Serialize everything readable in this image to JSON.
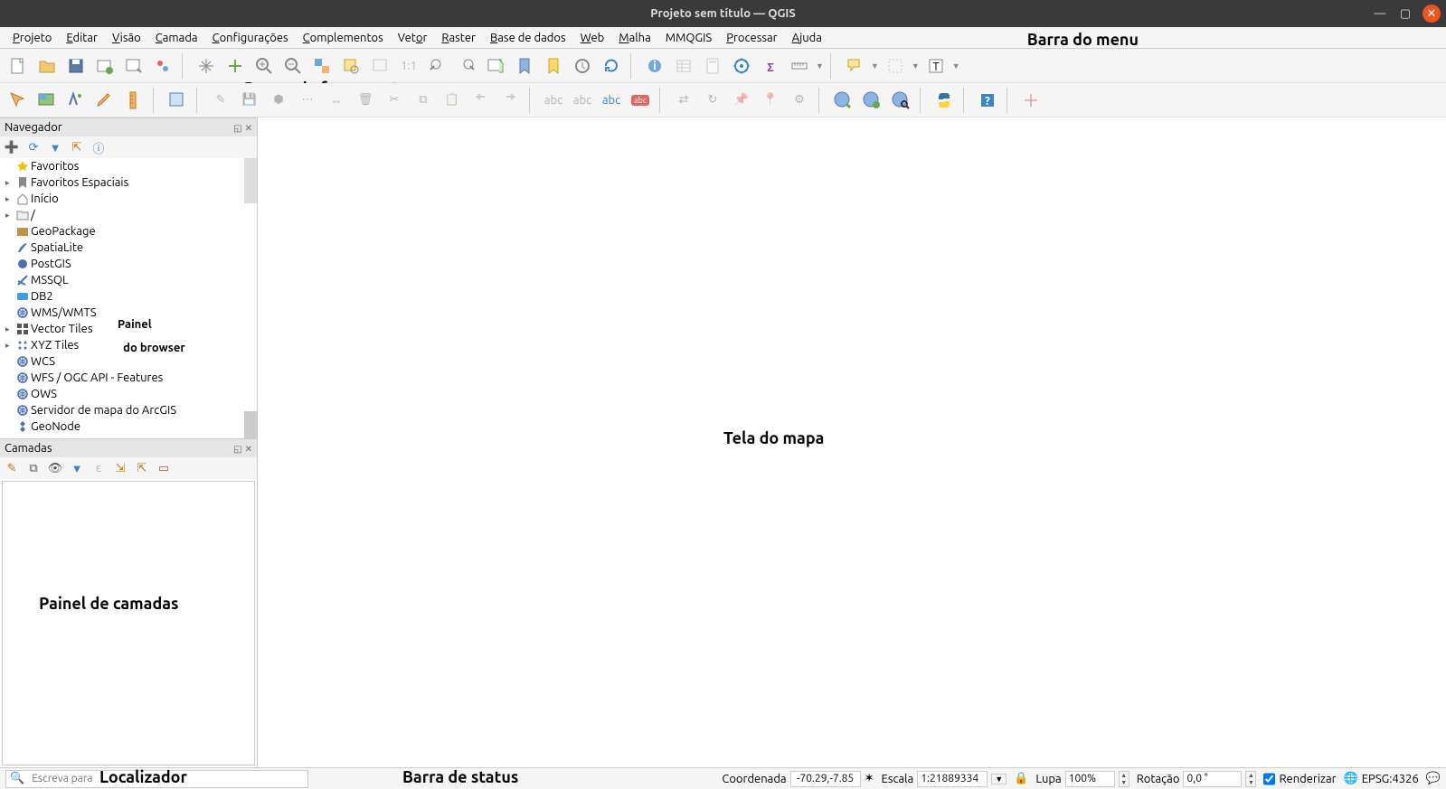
{
  "window": {
    "title": "Projeto sem título — QGIS"
  },
  "menu": {
    "items": [
      {
        "u": "P",
        "rest": "rojeto"
      },
      {
        "u": "E",
        "rest": "ditar"
      },
      {
        "u": "V",
        "rest": "isão"
      },
      {
        "u": "C",
        "rest": "amada"
      },
      {
        "u": "C",
        "rest": "onfigurações"
      },
      {
        "u": "C",
        "rest": "omplementos"
      },
      {
        "u": "",
        "rest": "Vetor",
        "u2": "o"
      },
      {
        "u": "R",
        "rest": "aster"
      },
      {
        "u": "B",
        "rest": "ase de dados"
      },
      {
        "u": "W",
        "rest": "eb"
      },
      {
        "u": "M",
        "rest": "alha"
      },
      {
        "u": "",
        "rest": "MMQGIS"
      },
      {
        "u": "P",
        "rest": "rocessar"
      },
      {
        "u": "A",
        "rest": "juda"
      }
    ]
  },
  "annotations": {
    "menu": "Barra do menu",
    "toolbars": "Barras de ferramentas",
    "browser_panel": "Painel do browser",
    "map": "Tela do mapa",
    "layers": "Painel de camadas",
    "locator": "Localizador",
    "statusbar": "Barra de status"
  },
  "panels": {
    "browser": {
      "title": "Navegador"
    },
    "layers": {
      "title": "Camadas"
    }
  },
  "browser_tree": [
    {
      "icon": "star",
      "color": "#f0c000",
      "label": "Favoritos",
      "exp": ""
    },
    {
      "icon": "bookmark",
      "color": "#888",
      "label": "Favoritos Espaciais",
      "exp": "▸"
    },
    {
      "icon": "home",
      "color": "#888",
      "label": "Início",
      "exp": "▸"
    },
    {
      "icon": "folder",
      "color": "#888",
      "label": "/",
      "exp": "▸"
    },
    {
      "icon": "geopkg",
      "color": "#c29340",
      "label": "GeoPackage",
      "exp": ""
    },
    {
      "icon": "feather",
      "color": "#4a70b0",
      "label": "SpatiaLite",
      "exp": ""
    },
    {
      "icon": "elephant",
      "color": "#4a70b0",
      "label": "PostGIS",
      "exp": ""
    },
    {
      "icon": "mssql",
      "color": "#4a70b0",
      "label": "MSSQL",
      "exp": ""
    },
    {
      "icon": "db2",
      "color": "#3fa0e0",
      "label": "DB2",
      "exp": ""
    },
    {
      "icon": "globe",
      "color": "#4a70b0",
      "label": "WMS/WMTS",
      "exp": ""
    },
    {
      "icon": "grid",
      "color": "#555",
      "label": "Vector Tiles",
      "exp": "▸"
    },
    {
      "icon": "xyz",
      "color": "#4a70b0",
      "label": "XYZ Tiles",
      "exp": "▸"
    },
    {
      "icon": "globe",
      "color": "#4a70b0",
      "label": "WCS",
      "exp": ""
    },
    {
      "icon": "globe",
      "color": "#4a70b0",
      "label": "WFS / OGC API - Features",
      "exp": ""
    },
    {
      "icon": "globe",
      "color": "#4a70b0",
      "label": "OWS",
      "exp": ""
    },
    {
      "icon": "globe",
      "color": "#4a70b0",
      "label": "Servidor de mapa do ArcGIS",
      "exp": ""
    },
    {
      "icon": "geonode",
      "color": "#4a70b0",
      "label": "GeoNode",
      "exp": ""
    }
  ],
  "status": {
    "locator_placeholder": "Escreva para",
    "coord_label": "Coordenada",
    "coord_value": "-70.29,-7.85",
    "scale_label": "Escala",
    "scale_value": "1:21889334",
    "magnifier_label": "Lupa",
    "magnifier_value": "100%",
    "rotation_label": "Rotação",
    "rotation_value": "0,0 °",
    "render_label": "Renderizar",
    "crs": "EPSG:4326"
  }
}
